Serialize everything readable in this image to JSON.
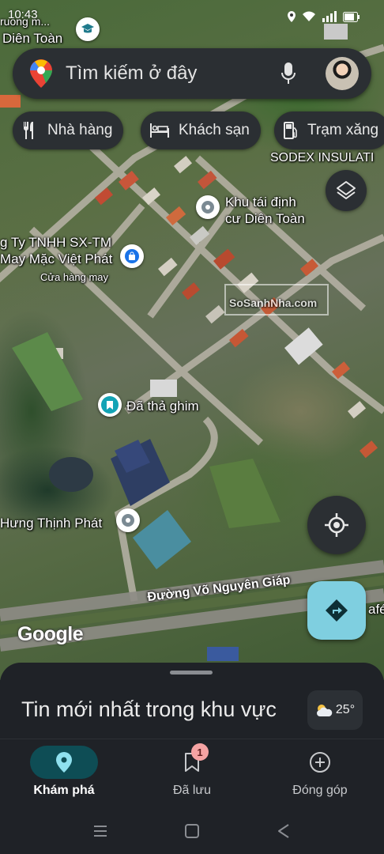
{
  "status_bar": {
    "time": "10:43"
  },
  "map": {
    "places": [
      {
        "name": "Dien Toan region label",
        "text": "Diên Toàn"
      },
      {
        "name": "resettlement-area",
        "line1": "Khu tái định",
        "line2": "cư Diên Toàn"
      },
      {
        "name": "garment-company",
        "line1": "g Ty TNHH SX-TM",
        "line2": "May Mặc Việt Phát",
        "sub": "Cửa hàng may"
      },
      {
        "name": "dropped-pin",
        "text": "Đã thả ghim"
      },
      {
        "name": "hung-thinh-phat",
        "text": "Hưng Thịnh Phát"
      },
      {
        "name": "sodex",
        "text": "SODEX INSULATI"
      },
      {
        "name": "top-left-partial",
        "text": "ruong m..."
      },
      {
        "name": "cafe-partial",
        "text": "afé"
      }
    ],
    "road": "Đường Võ Nguyên Giáp",
    "watermark": "SoSanhNha.com",
    "google_logo": "Google"
  },
  "search": {
    "placeholder": "Tìm kiếm ở đây"
  },
  "chips": [
    {
      "label": "Nhà hàng",
      "icon": "restaurant-icon"
    },
    {
      "label": "Khách sạn",
      "icon": "hotel-icon"
    },
    {
      "label": "Trạm xăng",
      "icon": "gas-station-icon"
    }
  ],
  "sheet": {
    "title": "Tin mới nhất trong khu vực",
    "temperature": "25°"
  },
  "bottom_nav": [
    {
      "label": "Khám phá",
      "icon": "explore-pin-icon",
      "active": true
    },
    {
      "label": "Đã lưu",
      "icon": "bookmark-icon",
      "badge": "1"
    },
    {
      "label": "Đóng góp",
      "icon": "add-circle-icon"
    }
  ],
  "colors": {
    "accent": "#7fcfe0",
    "active_pill": "#0e4d55",
    "surface": "#2b2f33",
    "background": "#1f2227"
  }
}
